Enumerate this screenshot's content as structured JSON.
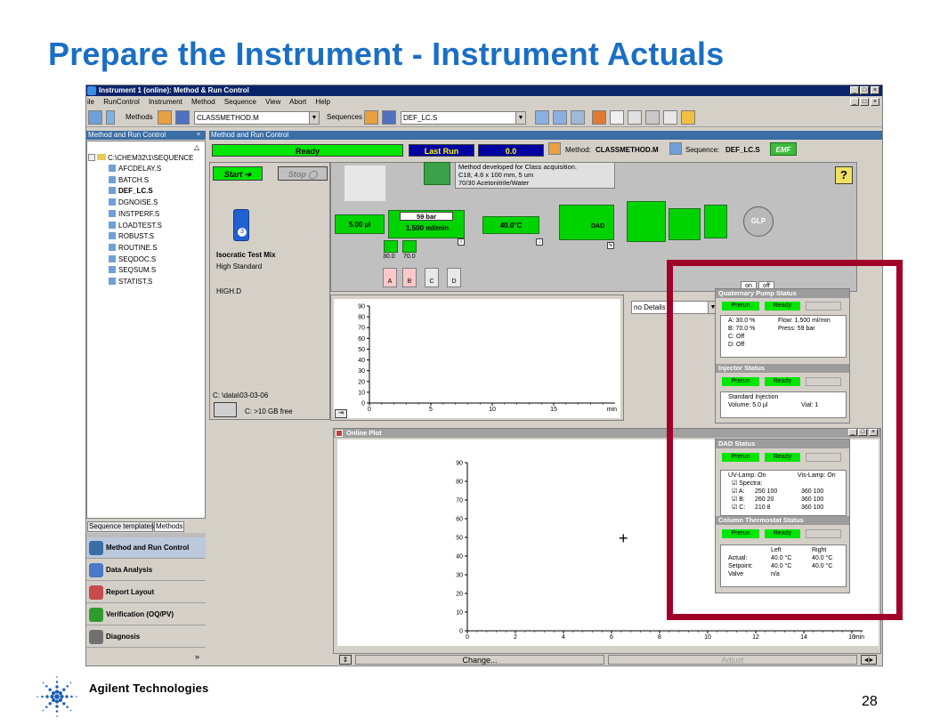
{
  "slide": {
    "title": "Prepare the Instrument - Instrument Actuals",
    "footer_brand": "Agilent Technologies",
    "page_number": "28"
  },
  "window": {
    "title": "Instrument 1 (online): Method & Run Control",
    "menu": [
      "ile",
      "RunControl",
      "Instrument",
      "Method",
      "Sequence",
      "View",
      "Abort",
      "Help"
    ],
    "methods_label": "Methods",
    "method_combo": "CLASSMETHOD.M",
    "sequences_label": "Sequences",
    "sequence_combo": "DEF_LC.S"
  },
  "left_pane": {
    "header": "Method and Run Control",
    "tree_root": "C:\\CHEM32\\1\\SEQUENCE",
    "tree_items": [
      "AFCDELAY.S",
      "BATCH.S",
      "DEF_LC.S",
      "DGNOISE.S",
      "INSTPERF.S",
      "LOADTEST.S",
      "ROBUST.S",
      "ROUTINE.S",
      "SEQDOC.S",
      "SEQSUM.S",
      "STATIST.S"
    ],
    "tabs": [
      "Sequence templates",
      "Methods"
    ],
    "nav": [
      {
        "label": "Method and Run Control",
        "color": "#3a6ea5"
      },
      {
        "label": "Data Analysis",
        "color": "#4b78c8"
      },
      {
        "label": "Report Layout",
        "color": "#c84b4b"
      },
      {
        "label": "Verification (OQ/PV)",
        "color": "#2f9a2f"
      },
      {
        "label": "Diagnosis",
        "color": "#707070"
      }
    ]
  },
  "main": {
    "header": "Method and Run Control",
    "status_ready": "Ready",
    "last_run_label": "Last Run",
    "last_run_value": "0.0",
    "method_label": "Method:",
    "method_name": "CLASSMETHOD.M",
    "sequence_label": "Sequence:",
    "sequence_name": "DEF_LC.S",
    "emf": "EMF",
    "start": "Start",
    "stop": "Stop",
    "method_desc": [
      "Method developed for Class acquisition.",
      "C18, 4.6 x 100 mm, 5 um",
      "70/30 Acetonitrile/Water"
    ],
    "vial_number": "3",
    "sample_name": "Isocratic Test Mix",
    "sample_desc": "High Standard",
    "data_file": "HIGH.D",
    "data_path": "C:  \\data\\03-03-06",
    "disk_free": "C: >10 GB free",
    "injector_volume": "5.00 µl",
    "pressure": "59 bar",
    "flow": "1.500 ml/min",
    "column_temp": "40.0°C",
    "dad_label": "DAD",
    "solvent_a_pct": "30.0",
    "solvent_b_pct": "70.0",
    "bottles": [
      "A",
      "B",
      "C",
      "D"
    ],
    "on_label": "on",
    "off_label": "off",
    "details_combo": "no Details",
    "change_label": "Change...",
    "adjust_label": "Adjust"
  },
  "plots": {
    "small_y_ticks": [
      "90",
      "80",
      "70",
      "60",
      "50",
      "40",
      "30",
      "20",
      "10",
      "0"
    ],
    "small_x_ticks": [
      "0",
      "5",
      "10",
      "15"
    ],
    "small_x_unit": "min",
    "online_title": "Online Plot",
    "online_y_ticks": [
      "90",
      "80",
      "70",
      "60",
      "50",
      "40",
      "30",
      "20",
      "10",
      "0"
    ],
    "online_x_ticks": [
      "0",
      "2",
      "4",
      "6",
      "8",
      "10",
      "12",
      "14",
      "16",
      "18"
    ],
    "online_x_unit": "min"
  },
  "status": {
    "prerun": "Prerun",
    "ready": "Ready",
    "pump_title": "Quaternary Pump Status",
    "pump_lines": [
      [
        "A:  30.0 %",
        "Flow:  1.500 ml/min"
      ],
      [
        "B:  70.0 %",
        "Press:      59 bar"
      ],
      [
        "C:      Off",
        ""
      ],
      [
        "D:      Off",
        ""
      ]
    ],
    "injector_title": "Injector Status",
    "injector_mode": "Standard Injection",
    "injector_volume": "Volume:  5.0 µl",
    "injector_vial": "Vial:  1",
    "dad_title": "DAD Status",
    "uv_lamp": "UV-Lamp:  On",
    "vis_lamp": "Vis-Lamp:  On",
    "spectra": "Spectra:",
    "dad_rows": [
      [
        "A:",
        "250 100",
        "360 100"
      ],
      [
        "B:",
        "260 20",
        "360 100"
      ],
      [
        "C:",
        "210 8",
        "360 100"
      ]
    ],
    "column_title": "Column Thermostat Status",
    "col_left": "Left",
    "col_right": "Right",
    "col_rows": [
      [
        "Actual:",
        "40.0 °C",
        "40.0 °C"
      ],
      [
        "Setpoint:",
        "40.0 °C",
        "40.0 °C"
      ],
      [
        "Valve",
        "n/a",
        ""
      ]
    ]
  }
}
